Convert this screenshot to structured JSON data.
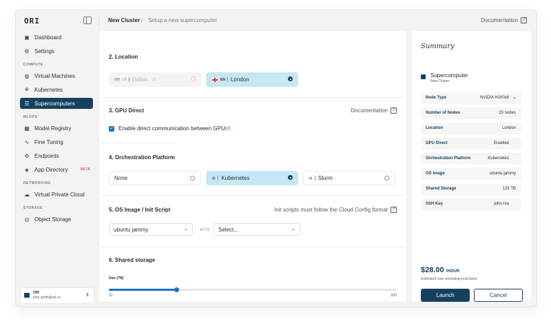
{
  "app": {
    "logo": "ORI"
  },
  "breadcrumb": {
    "title": "New Cluster",
    "separator": "/",
    "subtitle": "Setup a new supercomputer"
  },
  "header": {
    "documentation": "Documentation"
  },
  "sidebar": {
    "top": [
      {
        "label": "Dashboard",
        "icon": "dashboard-icon"
      },
      {
        "label": "Settings",
        "icon": "gear-icon"
      }
    ],
    "sections": [
      {
        "label": "COMPUTE",
        "items": [
          {
            "label": "Virtual Machines",
            "icon": "globe-icon"
          },
          {
            "label": "Kubernetes",
            "icon": "kubernetes-icon"
          },
          {
            "label": "Supercomputers",
            "icon": "server-icon",
            "active": true
          }
        ]
      },
      {
        "label": "MLOPS",
        "items": [
          {
            "label": "Model Registry",
            "icon": "grid-icon"
          },
          {
            "label": "Fine Tuning",
            "icon": "tuning-icon"
          },
          {
            "label": "Endpoints",
            "icon": "endpoint-icon"
          },
          {
            "label": "App Directory",
            "icon": "app-icon",
            "badge": "BETA"
          }
        ]
      },
      {
        "label": "NETWORKING",
        "items": [
          {
            "label": "Virtual Private Cloud",
            "icon": "cloud-icon"
          }
        ]
      },
      {
        "label": "STORAGE",
        "items": [
          {
            "label": "Object Storage",
            "icon": "storage-icon"
          }
        ]
      }
    ],
    "account": {
      "name": "ORI",
      "email": "john.smith@ori.co"
    }
  },
  "main": {
    "location": {
      "title": "2. Location",
      "options": [
        {
          "code": "US",
          "city": "Dallas",
          "state": "disabled"
        },
        {
          "code": "EN",
          "city": "London",
          "state": "selected"
        }
      ]
    },
    "gpu": {
      "title": "3. GPU Direct",
      "link": "Documentation",
      "checkbox_label": "Enable direct communication between GPUs",
      "checked": true
    },
    "orchestration": {
      "title": "4. Orchestration Platform",
      "options": [
        {
          "label": "None",
          "selected": false
        },
        {
          "label": "Kubernetes",
          "selected": true
        },
        {
          "label": "Slurm",
          "selected": false
        }
      ]
    },
    "os": {
      "title": "5. OS Image / Init Script",
      "link": "Init scripts must follow the Cloud Config format",
      "image_value": "ubuntu jammy",
      "with_label": "WITH",
      "script_value": "Select..."
    },
    "storage": {
      "title": "6. Shared storage",
      "size_label": "Size (TB)",
      "min": "10",
      "max": "500",
      "value": 125,
      "min_value": 10,
      "max_value": 500
    }
  },
  "summary": {
    "title": "Summary",
    "product": "Supercomputer",
    "product_sub": "New Cluster",
    "rows": [
      {
        "key": "Node Type",
        "value": "NVIDIA H200x8"
      },
      {
        "key": "Number of Nodes",
        "value": "25 nodes"
      },
      {
        "key": "Location",
        "value": "London"
      },
      {
        "key": "GPU Direct",
        "value": "Enabled"
      },
      {
        "key": "Orchestration Platform",
        "value": "Kubernetes"
      },
      {
        "key": "OS Image",
        "value": "ubuntu-jammy"
      },
      {
        "key": "Shared Storage",
        "value": "125 TB"
      },
      {
        "key": "SSH Key",
        "value": "john-rsa"
      }
    ],
    "price": "$28.00",
    "price_unit": "/HOUR",
    "price_note": "Estimated cost, excluding local taxes.",
    "launch": "Launch",
    "cancel": "Cancel"
  }
}
